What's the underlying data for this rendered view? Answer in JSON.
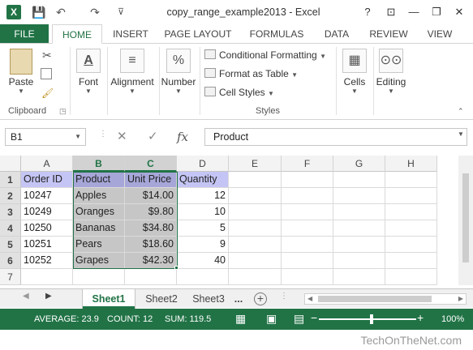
{
  "window": {
    "title": "copy_range_example2013 - Excel",
    "help": "?",
    "controls": [
      "⊡",
      "—",
      "❐",
      "✕"
    ]
  },
  "qat": {
    "save": "💾",
    "undo": "↶",
    "redo": "↷",
    "more": "⊽"
  },
  "ribbon_tabs": [
    "FILE",
    "HOME",
    "INSERT",
    "PAGE LAYOUT",
    "FORMULAS",
    "DATA",
    "REVIEW",
    "VIEW"
  ],
  "ribbon": {
    "clipboard": {
      "paste": "Paste",
      "label": "Clipboard"
    },
    "font": {
      "label": "Font",
      "glyph": "A"
    },
    "alignment": {
      "label": "Alignment",
      "glyph": "≡"
    },
    "number": {
      "label": "Number",
      "glyph": "%"
    },
    "styles": {
      "conditional": "Conditional Formatting",
      "format_table": "Format as Table",
      "cell_styles": "Cell Styles",
      "label": "Styles"
    },
    "cells": {
      "label": "Cells"
    },
    "editing": {
      "label": "Editing"
    }
  },
  "formula_bar": {
    "name_box": "B1",
    "value": "Product",
    "fx": "fx"
  },
  "columns": [
    "A",
    "B",
    "C",
    "D",
    "E",
    "F",
    "G",
    "H"
  ],
  "rows": [
    "1",
    "2",
    "3",
    "4",
    "5",
    "6",
    "7"
  ],
  "sheet": {
    "headers": [
      "Order ID",
      "Product",
      "Unit Price",
      "Quantity"
    ],
    "data": [
      [
        "10247",
        "Apples",
        "$14.00",
        "12"
      ],
      [
        "10249",
        "Oranges",
        "$9.80",
        "10"
      ],
      [
        "10250",
        "Bananas",
        "$34.80",
        "5"
      ],
      [
        "10251",
        "Pears",
        "$18.60",
        "9"
      ],
      [
        "10252",
        "Grapes",
        "$42.30",
        "40"
      ]
    ]
  },
  "sheet_tabs": [
    "Sheet1",
    "Sheet2",
    "Sheet3"
  ],
  "sheet_tab_more": "...",
  "status": {
    "average": "AVERAGE: 23.9",
    "count": "COUNT: 12",
    "sum": "SUM: 119.5",
    "zoom": "100%"
  },
  "watermark": "TechOnTheNet.com",
  "colors": {
    "excel_green": "#217346",
    "header_fill": "#c5c5f5",
    "selection_fill": "#c6c6c6"
  }
}
